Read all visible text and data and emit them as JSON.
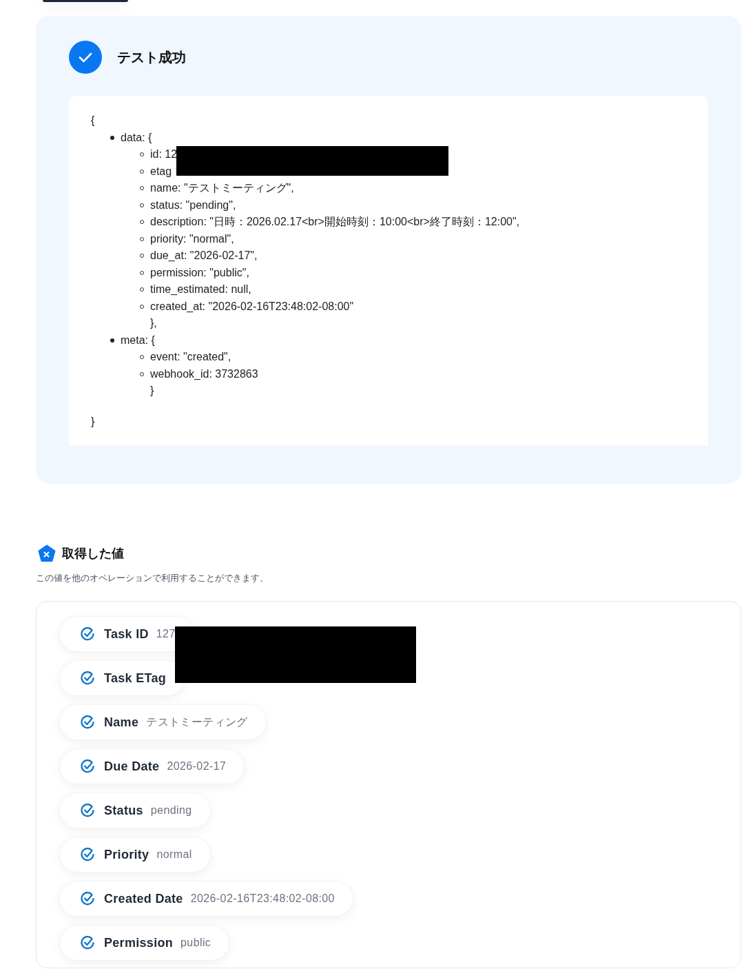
{
  "result": {
    "title": "テスト成功",
    "code": {
      "open": "{",
      "close": "}",
      "entries": [
        {
          "label": "data: {",
          "close": "},",
          "children": [
            "id: 12",
            "etag",
            "name: \"テストミーティング\",",
            "status: \"pending\",",
            "description: \"日時：2026.02.17<br>開始時刻：10:00<br>終了時刻：12:00\",",
            "priority: \"normal\",",
            "due_at: \"2026-02-17\",",
            "permission: \"public\",",
            "time_estimated: null,",
            "created_at: \"2026-02-16T23:48:02-08:00\""
          ]
        },
        {
          "label": "meta: {",
          "close": "}",
          "children": [
            "event: \"created\",",
            "webhook_id: 3732863"
          ]
        }
      ]
    }
  },
  "values": {
    "title": "取得した値",
    "description": "この値を他のオペレーションで利用することができます。",
    "items": [
      {
        "label": "Task ID",
        "value": "127"
      },
      {
        "label": "Task ETag"
      },
      {
        "label": "Name",
        "value": "テストミーティング"
      },
      {
        "label": "Due Date",
        "value": "2026-02-17"
      },
      {
        "label": "Status",
        "value": "pending"
      },
      {
        "label": "Priority",
        "value": "normal"
      },
      {
        "label": "Created Date",
        "value": "2026-02-16T23:48:02-08:00"
      },
      {
        "label": "Permission",
        "value": "public"
      }
    ]
  }
}
